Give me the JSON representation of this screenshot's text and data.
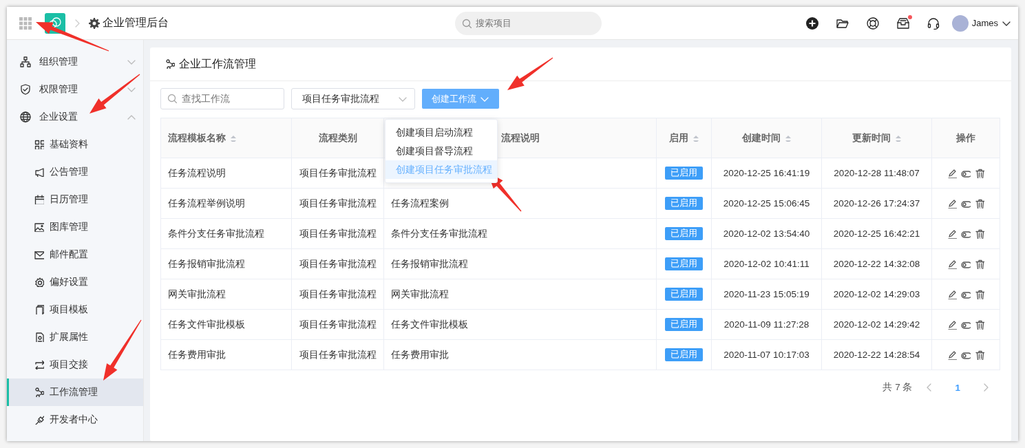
{
  "header": {
    "title": "企业管理后台",
    "search": {
      "placeholder": "搜索项目"
    },
    "toolbar": [
      {
        "dot": false
      },
      {
        "dot": false
      },
      {
        "dot": false
      },
      {
        "dot": true
      },
      {
        "dot": false
      }
    ],
    "user": {
      "name": "James"
    }
  },
  "sidebar": {
    "items": [
      {
        "label": "组织管理",
        "expanded": false
      },
      {
        "label": "权限管理",
        "expanded": false
      },
      {
        "label": "企业设置",
        "expanded": true,
        "children": [
          {
            "label": "基础资料",
            "selected": false
          },
          {
            "label": "公告管理",
            "selected": false
          },
          {
            "label": "日历管理",
            "selected": false
          },
          {
            "label": "图库管理",
            "selected": false
          },
          {
            "label": "邮件配置",
            "selected": false
          },
          {
            "label": "偏好设置",
            "selected": false
          },
          {
            "label": "项目模板",
            "selected": false
          },
          {
            "label": "扩展属性",
            "selected": false
          },
          {
            "label": "项目交接",
            "selected": false
          },
          {
            "label": "工作流管理",
            "selected": true
          },
          {
            "label": "开发者中心",
            "selected": false
          }
        ]
      }
    ]
  },
  "page": {
    "title": "企业工作流管理",
    "search": {
      "placeholder": "查找工作流"
    },
    "filter": {
      "value": "项目任务审批流程"
    },
    "create_button": {
      "label": "创建工作流",
      "menu": [
        {
          "label": "创建项目启动流程",
          "selected": false
        },
        {
          "label": "创建项目督导流程",
          "selected": false
        },
        {
          "label": "创建项目任务审批流程",
          "selected": true
        }
      ]
    },
    "table": {
      "columns": [
        {
          "label": "流程模板名称",
          "sortable": true
        },
        {
          "label": "流程类别",
          "sortable": false
        },
        {
          "label": "流程说明",
          "sortable": false
        },
        {
          "label": "启用",
          "sortable": true
        },
        {
          "label": "创建时间",
          "sortable": true
        },
        {
          "label": "更新时间",
          "sortable": true
        },
        {
          "label": "操作",
          "sortable": false
        }
      ],
      "rows": [
        {
          "name": "任务流程说明",
          "category": "项目任务审批流程",
          "status": "已启用",
          "created": "2020-12-25 16:41:19",
          "updated": "2020-12-28 11:48:07"
        },
        {
          "name": "任务流程举例说明",
          "category": "项目任务审批流程",
          "description": "任务流程案例",
          "status": "已启用",
          "created": "2020-12-25 15:06:45",
          "updated": "2020-12-26 17:24:37"
        },
        {
          "name": "条件分支任务审批流程",
          "category": "项目任务审批流程",
          "description": "条件分支任务审批流程",
          "status": "已启用",
          "created": "2020-12-02 13:54:40",
          "updated": "2020-12-25 16:42:21"
        },
        {
          "name": "任务报销审批流程",
          "category": "项目任务审批流程",
          "description": "任务报销审批流程",
          "status": "已启用",
          "created": "2020-12-02 10:41:11",
          "updated": "2020-12-22 14:32:08"
        },
        {
          "name": "网关审批流程",
          "category": "项目任务审批流程",
          "description": "网关审批流程",
          "status": "已启用",
          "created": "2020-11-23 15:05:19",
          "updated": "2020-12-02 14:29:03"
        },
        {
          "name": "任务文件审批模板",
          "category": "项目任务审批流程",
          "description": "任务文件审批模板",
          "status": "已启用",
          "created": "2020-11-09 11:27:28",
          "updated": "2020-12-02 14:29:42"
        },
        {
          "name": "任务费用审批",
          "category": "项目任务审批流程",
          "description": "任务费用审批",
          "status": "已启用",
          "created": "2020-11-07 10:17:03",
          "updated": "2020-12-22 14:28:54"
        }
      ]
    },
    "pagination": {
      "total": "共 7 条",
      "pages": [
        {
          "label": "1",
          "selected": true
        }
      ]
    }
  },
  "annotations": [
    {
      "kind": "arrow"
    },
    {
      "kind": "arrow"
    },
    {
      "kind": "arrow"
    },
    {
      "kind": "arrow"
    },
    {
      "kind": "arrow"
    }
  ]
}
